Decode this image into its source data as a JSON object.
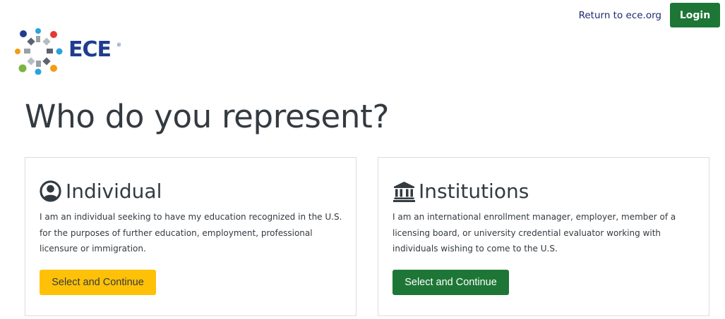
{
  "header": {
    "return_link": "Return to ece.org",
    "login_label": "Login"
  },
  "logo": {
    "text": "ECE",
    "reg_mark": "®"
  },
  "page": {
    "title": "Who do you represent?"
  },
  "cards": [
    {
      "title": "Individual",
      "icon": "user-circle-icon",
      "description": "I am an individual seeking to have my education recognized in the U.S. for the purposes of further education, employment, professional licensure or immigration.",
      "button_label": "Select and Continue",
      "button_color": "#ffc107"
    },
    {
      "title": "Institutions",
      "icon": "institution-building-icon",
      "description": "I am an international enrollment manager, employer, member of a licensing board, or university credential evaluator working with individuals wishing to come to the U.S.",
      "button_label": "Select and Continue",
      "button_color": "#1e7636"
    }
  ],
  "colors": {
    "brand_blue": "#1f3c8f",
    "primary_green": "#1e7636",
    "accent_yellow": "#ffc107",
    "text_dark": "#333a40"
  }
}
